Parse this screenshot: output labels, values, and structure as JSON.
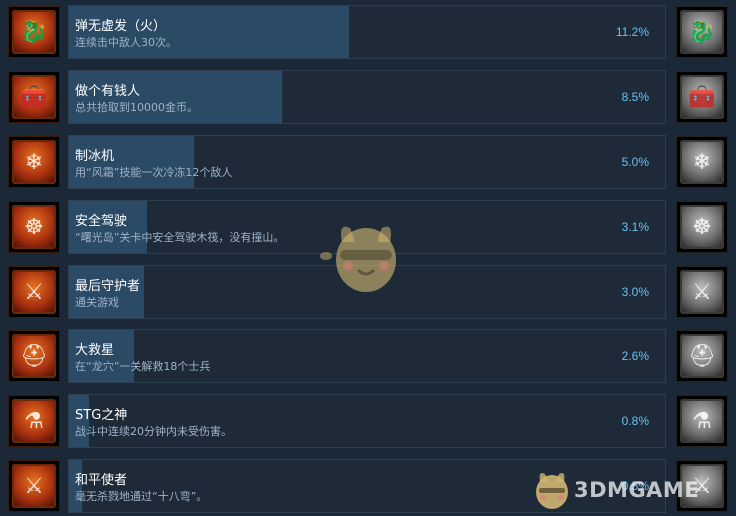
{
  "achievements": [
    {
      "name": "弹无虚发（火）",
      "desc": "连续击中敌人30次。",
      "percent": "11.2%",
      "unlock_fraction": 0.112,
      "icon": "dragon-icon",
      "locked_icon": "dragon-gray-icon",
      "glyph": "🐉"
    },
    {
      "name": "做个有钱人",
      "desc": "总共拾取到10000金币。",
      "percent": "8.5%",
      "unlock_fraction": 0.085,
      "icon": "treasure-chest-icon",
      "locked_icon": "treasure-chest-gray-icon",
      "glyph": "🧰"
    },
    {
      "name": "制冰机",
      "desc": "用“风霜”技能一次冷冻12个敌人",
      "percent": "5.0%",
      "unlock_fraction": 0.05,
      "icon": "ice-crystal-icon",
      "locked_icon": "ice-crystal-gray-icon",
      "glyph": "❄"
    },
    {
      "name": "安全驾驶",
      "desc": "“曙光岛”关卡中安全驾驶木筏，没有撞山。",
      "percent": "3.1%",
      "unlock_fraction": 0.031,
      "icon": "ship-wheel-icon",
      "locked_icon": "ship-wheel-gray-icon",
      "glyph": "☸"
    },
    {
      "name": "最后守护者",
      "desc": "通关游戏",
      "percent": "3.0%",
      "unlock_fraction": 0.03,
      "icon": "game-logo-icon",
      "locked_icon": "game-logo-gray-icon",
      "glyph": "⚔"
    },
    {
      "name": "大救星",
      "desc": "在“龙穴”一关解救18个士兵",
      "percent": "2.6%",
      "unlock_fraction": 0.026,
      "icon": "knight-helmet-icon",
      "locked_icon": "knight-helmet-gray-icon",
      "glyph": "⛑"
    },
    {
      "name": "STG之神",
      "desc": "战斗中连续20分钟内未受伤害。",
      "percent": "0.8%",
      "unlock_fraction": 0.008,
      "icon": "potion-icon",
      "locked_icon": "potion-gray-icon",
      "glyph": "⚗"
    },
    {
      "name": "和平使者",
      "desc": "毫无杀戮地通过“十八弯”。",
      "percent": "0.5%",
      "unlock_fraction": 0.005,
      "icon": "crossed-swords-icon",
      "locked_icon": "crossed-swords-gray-icon",
      "glyph": "⚔"
    }
  ],
  "watermark": {
    "text": "3DMGAME"
  },
  "colors": {
    "background": "#1b2838",
    "panel": "#1e2a38",
    "bar": "#2b4a66",
    "percent": "#67c1f5",
    "desc": "#9fb3c8"
  }
}
